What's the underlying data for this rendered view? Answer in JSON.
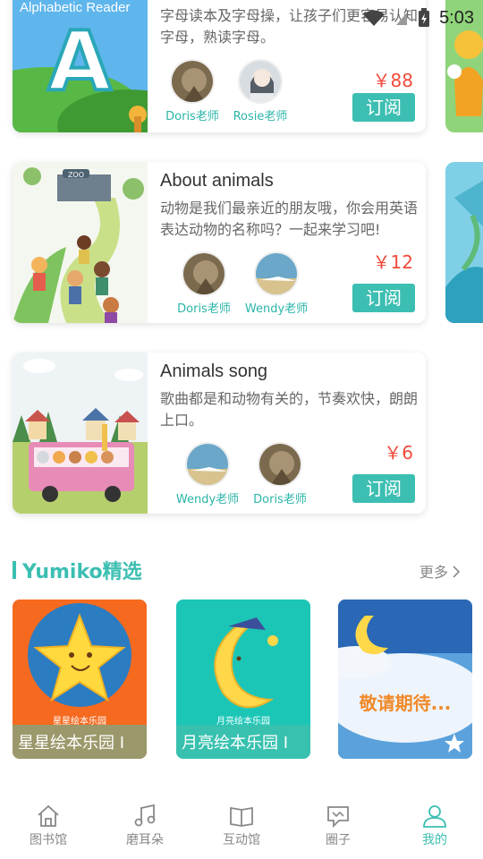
{
  "status_bar": {
    "time": "5:03"
  },
  "courses": [
    {
      "thumb_text": "Alphabetic Reader",
      "title": "",
      "desc": "字母读本及字母操，让孩子们更容易认知字母，熟读字母。",
      "teachers": [
        "Doris老师",
        "Rosie老师"
      ],
      "price": "￥88",
      "button": "订阅"
    },
    {
      "title": "About animals",
      "desc": "动物是我们最亲近的朋友哦，你会用英语表达动物的名称吗？一起来学习吧!",
      "teachers": [
        "Doris老师",
        "Wendy老师"
      ],
      "price": "￥12",
      "button": "订阅"
    },
    {
      "title": "Animals song",
      "desc": "歌曲都是和动物有关的，节奏欢快，朗朗上口。",
      "teachers": [
        "Wendy老师",
        "Doris老师"
      ],
      "price": "￥6",
      "button": "订阅"
    }
  ],
  "section": {
    "title": "Yumiko精选",
    "more": "更多"
  },
  "picks": [
    {
      "caption": "星星绘本乐园 I",
      "banner": "星星绘本乐园"
    },
    {
      "caption": "月亮绘本乐园 I",
      "banner": "月亮绘本乐园"
    },
    {
      "caption": "",
      "banner": "敬请期待..."
    }
  ],
  "tabs": [
    {
      "label": "图书馆",
      "icon": "home-icon"
    },
    {
      "label": "磨耳朵",
      "icon": "music-icon"
    },
    {
      "label": "互动馆",
      "icon": "book-icon"
    },
    {
      "label": "圈子",
      "icon": "chat-icon"
    },
    {
      "label": "我的",
      "icon": "user-icon",
      "active": true
    }
  ],
  "colors": {
    "accent": "#3cbfb2",
    "price": "#f04b3c"
  }
}
